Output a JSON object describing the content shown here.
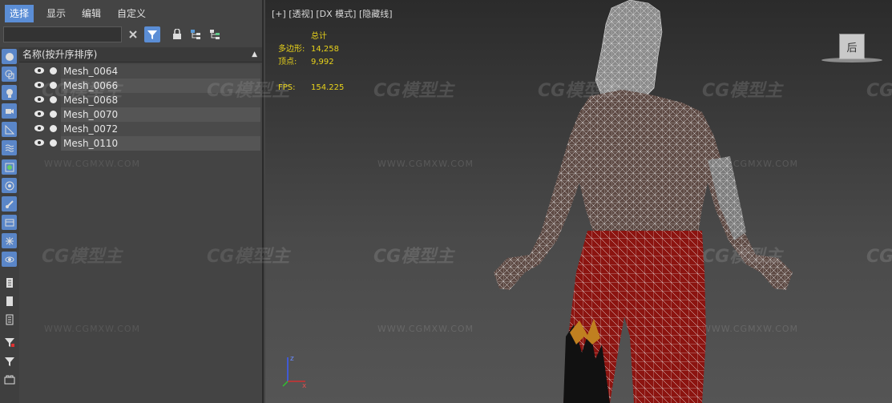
{
  "explorer": {
    "menu": [
      {
        "label": "选择",
        "active": true
      },
      {
        "label": "显示",
        "active": false
      },
      {
        "label": "编辑",
        "active": false
      },
      {
        "label": "自定义",
        "active": false
      }
    ],
    "search": {
      "value": "",
      "placeholder": ""
    },
    "column_header": "名称(按升序排序)",
    "rows": [
      {
        "name": "Mesh_0064"
      },
      {
        "name": "Mesh_0066"
      },
      {
        "name": "Mesh_0068"
      },
      {
        "name": "Mesh_0070"
      },
      {
        "name": "Mesh_0072"
      },
      {
        "name": "Mesh_0110"
      }
    ]
  },
  "viewport": {
    "label": "[+] [透视] [DX 模式] [隐藏线]",
    "stats": {
      "title": "总计",
      "polys_label": "多边形:",
      "polys": "14,258",
      "verts_label": "顶点:",
      "verts": "9,992",
      "fps_label": "FPS:",
      "fps": "154.225"
    },
    "viewcube_face": "后",
    "axis": {
      "z": "z",
      "x": "x"
    }
  },
  "watermark": {
    "logo": "CG模型主",
    "url": "WWW.CGMXW.COM"
  },
  "colors": {
    "accent": "#5b8ed6",
    "stats": "#e8d21a"
  }
}
